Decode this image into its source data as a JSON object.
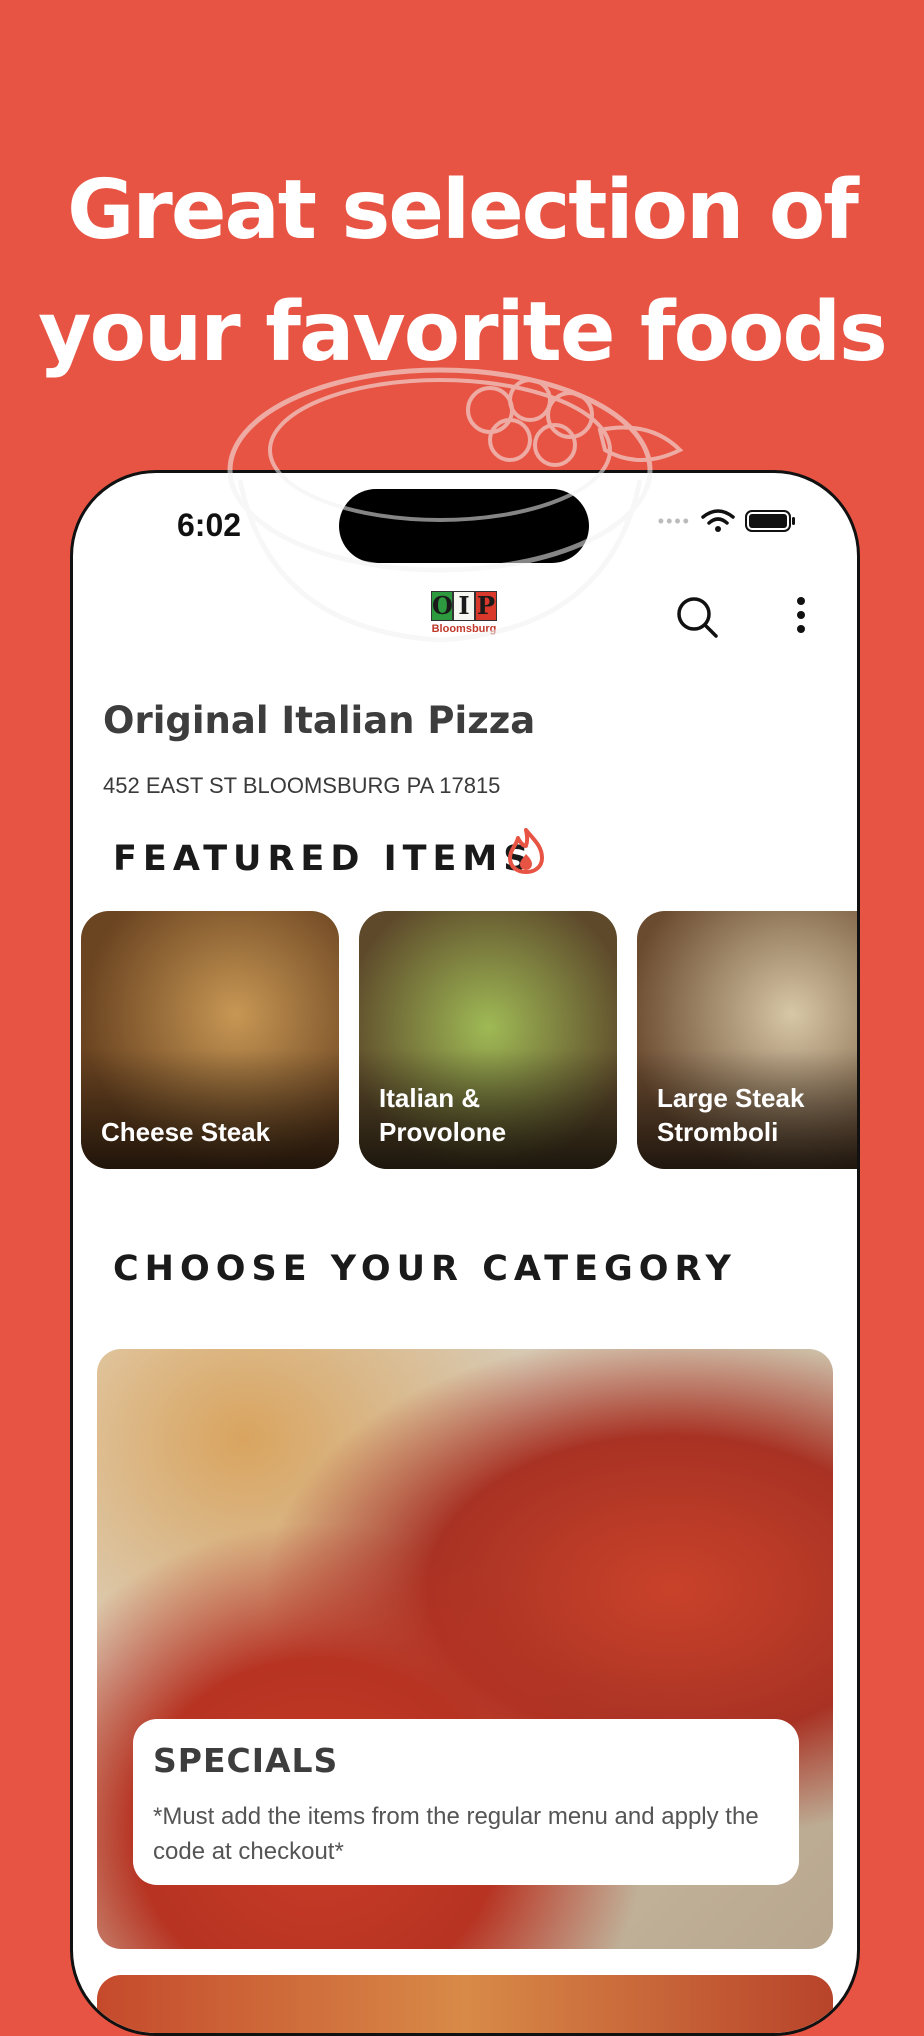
{
  "headline": {
    "line1": "Great selection of",
    "line2": "your favorite foods"
  },
  "status_bar": {
    "time": "6:02"
  },
  "header": {
    "logo_text": "OIP",
    "logo_letters": [
      "O",
      "I",
      "P"
    ],
    "logo_subtext": "Bloomsburg",
    "search_icon": "search-icon",
    "menu_icon": "more-vertical-icon"
  },
  "store": {
    "name": "Original Italian Pizza",
    "address": "452 EAST ST BLOOMSBURG PA 17815"
  },
  "featured": {
    "title": "FEATURED ITEMS",
    "icon": "fire-icon",
    "items": [
      {
        "label": "Cheese Steak"
      },
      {
        "label": "Italian & Provolone"
      },
      {
        "label": "Large Steak Stromboli"
      }
    ]
  },
  "categories": {
    "title": "CHOOSE YOUR CATEGORY",
    "items": [
      {
        "title": "SPECIALS",
        "description": "*Must add the items from the regular menu and apply the code at checkout*"
      }
    ]
  },
  "colors": {
    "background": "#E85444",
    "accent": "#E85444",
    "text_dark": "#1a1a1a"
  }
}
